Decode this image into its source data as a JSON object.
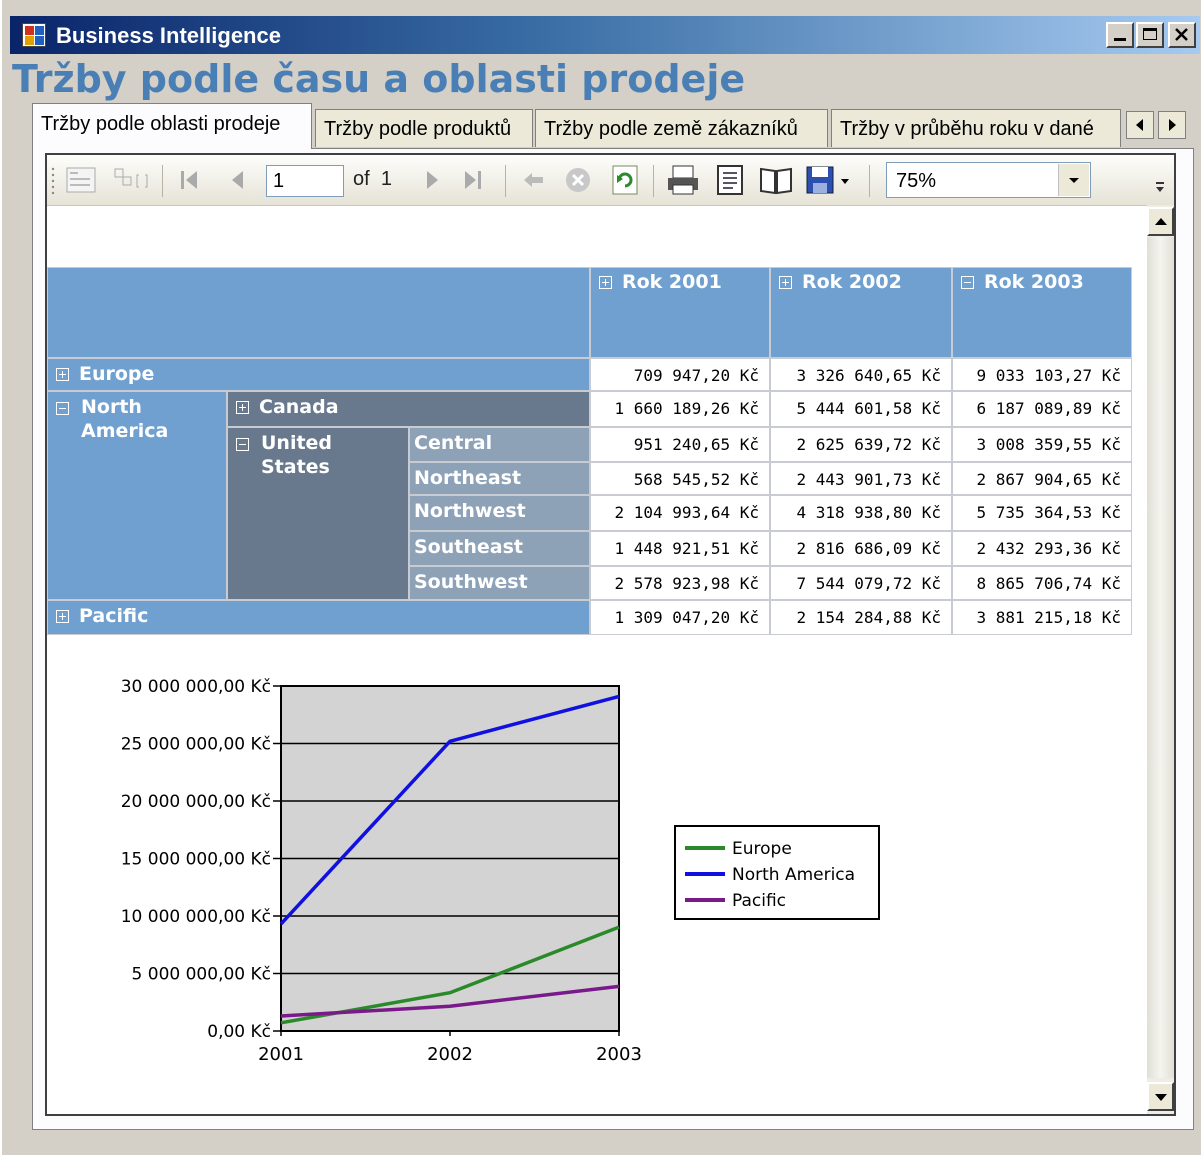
{
  "window": {
    "title": "Business Intelligence"
  },
  "tabs": [
    {
      "label": "Tržby podle oblasti prodeje",
      "active": true
    },
    {
      "label": "Tržby podle produktů",
      "active": false
    },
    {
      "label": "Tržby podle země zákazníků",
      "active": false
    },
    {
      "label": "Tržby v průběhu roku v dané",
      "active": false
    }
  ],
  "toolbar": {
    "page_value": "1",
    "of_label": "of",
    "total_pages": "1",
    "zoom_value": "75%"
  },
  "report": {
    "title": "Tržby podle času a oblasti prodeje",
    "columns": [
      "Rok 2001",
      "Rok 2002",
      "Rok 2003"
    ],
    "column_toggles": [
      "plus",
      "plus",
      "minus"
    ],
    "rows": {
      "europe": {
        "label": "Europe",
        "values": [
          "709 947,20 Kč",
          "3 326 640,65 Kč",
          "9 033 103,27 Kč"
        ]
      },
      "north_america": {
        "label": "North America"
      },
      "canada": {
        "label": "Canada",
        "values": [
          "1 660 189,26 Kč",
          "5 444 601,58 Kč",
          "6 187 089,89 Kč"
        ]
      },
      "united_states": {
        "label": "United States"
      },
      "central": {
        "label": "Central",
        "values": [
          "951 240,65 Kč",
          "2 625 639,72 Kč",
          "3 008 359,55 Kč"
        ]
      },
      "northeast": {
        "label": "Northeast",
        "values": [
          "568 545,52 Kč",
          "2 443 901,73 Kč",
          "2 867 904,65 Kč"
        ]
      },
      "northwest": {
        "label": "Northwest",
        "values": [
          "2 104 993,64 Kč",
          "4 318 938,80 Kč",
          "5 735 364,53 Kč"
        ]
      },
      "southeast": {
        "label": "Southeast",
        "values": [
          "1 448 921,51 Kč",
          "2 816 686,09 Kč",
          "2 432 293,36 Kč"
        ]
      },
      "southwest": {
        "label": "Southwest",
        "values": [
          "2 578 923,98 Kč",
          "7 544 079,72 Kč",
          "8 865 706,74 Kč"
        ]
      },
      "pacific": {
        "label": "Pacific",
        "values": [
          "1 309 047,20 Kč",
          "2 154 284,88 Kč",
          "3 881 215,18 Kč"
        ]
      }
    }
  },
  "colors": {
    "europe": "#2a8a2a",
    "north_america": "#1010e0",
    "pacific": "#7a1a8a",
    "plot_bg": "#d3d3d3"
  },
  "chart_data": {
    "type": "line",
    "x": [
      "2001",
      "2002",
      "2003"
    ],
    "series": [
      {
        "name": "Europe",
        "values": [
          709947.2,
          3326640.65,
          9033103.27
        ]
      },
      {
        "name": "North America",
        "values": [
          9312815.07,
          25193847.64,
          29096718.72
        ]
      },
      {
        "name": "Pacific",
        "values": [
          1309047.2,
          2154284.88,
          3881215.18
        ]
      }
    ],
    "y_ticks": [
      "0,00 Kč",
      "5 000 000,00 Kč",
      "10 000 000,00 Kč",
      "15 000 000,00 Kč",
      "20 000 000,00 Kč",
      "25 000 000,00 Kč",
      "30 000 000,00 Kč"
    ],
    "ylim": [
      0,
      30000000
    ],
    "grid": true,
    "legend": "right"
  }
}
